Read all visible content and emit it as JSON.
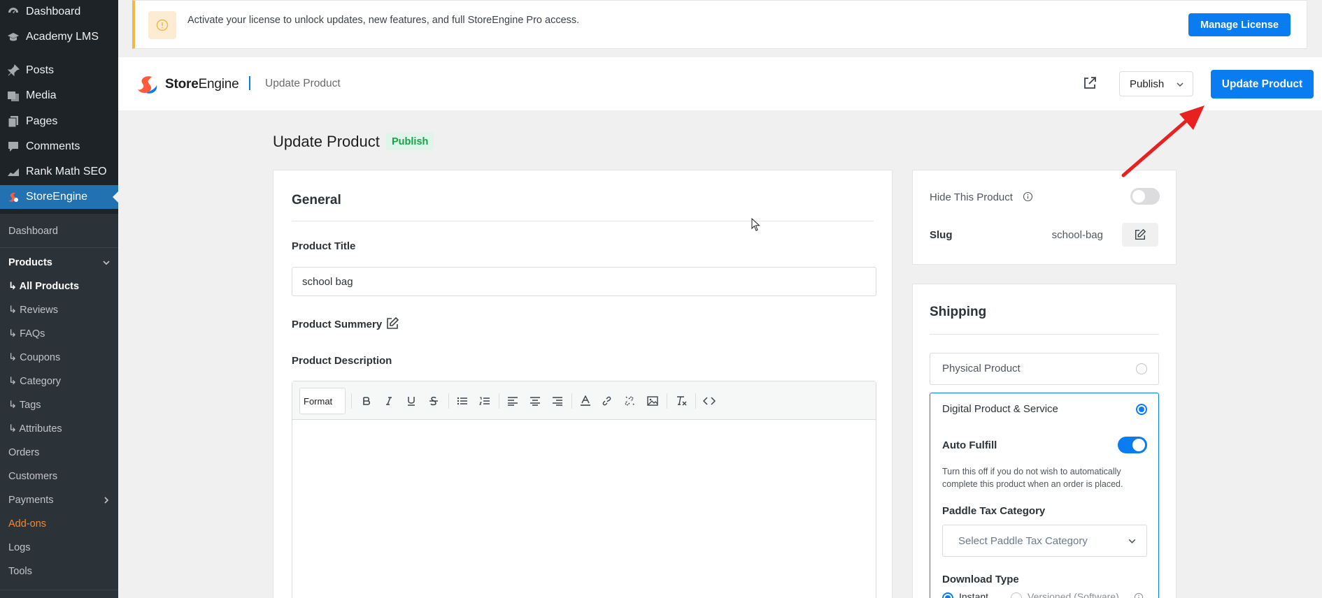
{
  "sidebar": {
    "top_items": [
      {
        "label": "Dashboard",
        "icon": "dashboard-icon"
      },
      {
        "label": "Academy LMS",
        "icon": "graduation-cap-icon"
      },
      {
        "label": "Posts",
        "icon": "pin-icon"
      },
      {
        "label": "Media",
        "icon": "media-icon"
      },
      {
        "label": "Pages",
        "icon": "pages-icon"
      },
      {
        "label": "Comments",
        "icon": "comment-icon"
      },
      {
        "label": "Rank Math SEO",
        "icon": "rank-math-icon"
      },
      {
        "label": "StoreEngine",
        "icon": "storeengine-icon"
      }
    ],
    "submenu": {
      "dashboard": "Dashboard",
      "products": "Products",
      "all_products": "↳ All Products",
      "reviews": "↳ Reviews",
      "faqs": "↳ FAQs",
      "coupons": "↳ Coupons",
      "category": "↳ Category",
      "tags": "↳ Tags",
      "attributes": "↳ Attributes",
      "orders": "Orders",
      "customers": "Customers",
      "payments": "Payments",
      "addons": "Add-ons",
      "logs": "Logs",
      "tools": "Tools"
    }
  },
  "notice": {
    "text": "Activate your license to unlock updates, new features, and full StoreEngine Pro access.",
    "button": "Manage License",
    "accent": "#f0b849"
  },
  "header": {
    "brand_bold": "Store",
    "brand_rest": "Engine",
    "breadcrumb": "Update Product",
    "status": "Publish",
    "update_button": "Update Product"
  },
  "page": {
    "title": "Update Product",
    "status_badge": "Publish"
  },
  "general": {
    "heading": "General",
    "product_title_label": "Product Title",
    "product_title_value": "school bag",
    "summary_label": "Product Summery",
    "description_label": "Product Description",
    "format_label": "Format"
  },
  "visibility": {
    "hide_label": "Hide This Product",
    "hide_enabled": false,
    "slug_label": "Slug",
    "slug_value": "school-bag"
  },
  "shipping": {
    "heading": "Shipping",
    "physical_label": "Physical Product",
    "digital_label": "Digital Product & Service",
    "selected": "digital",
    "auto_fulfill_label": "Auto Fulfill",
    "auto_fulfill_enabled": true,
    "auto_fulfill_help": "Turn this off if you do not wish to automatically complete this product when an order is placed.",
    "tax_category_label": "Paddle Tax Category",
    "tax_category_placeholder": "Select Paddle Tax Category",
    "download_type_label": "Download Type",
    "download_options": [
      "Instant",
      "Versioned (Software)"
    ]
  },
  "colors": {
    "primary": "#0a7cf1",
    "sidebar_bg": "#1d2327",
    "active_menu": "#2271b1",
    "arrow": "#e8201f"
  }
}
